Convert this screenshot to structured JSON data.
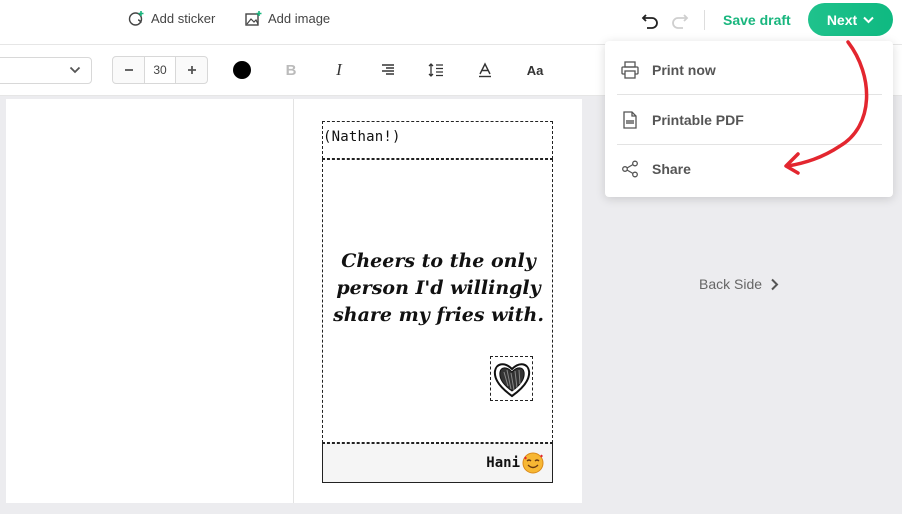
{
  "topbar": {
    "add_sticker": "Add sticker",
    "add_image": "Add image",
    "save_draft": "Save draft",
    "next": "Next"
  },
  "toolbar": {
    "font_size": "30",
    "text_color": "#000000",
    "icons": [
      "bold-icon",
      "italic-icon",
      "align-right-icon",
      "line-height-icon",
      "text-color-icon",
      "text-case-icon"
    ],
    "bold_glyph": "B",
    "italic_glyph": "I",
    "case_glyph": "Aa"
  },
  "card": {
    "name": "(Nathan!)",
    "message": "Cheers to the only person I'd willingly share my fries with.",
    "signature": "Hani"
  },
  "back_side": "Back Side",
  "dropdown": {
    "items": [
      {
        "label": "Print now",
        "icon": "printer-icon"
      },
      {
        "label": "Printable PDF",
        "icon": "pdf-icon"
      },
      {
        "label": "Share",
        "icon": "share-icon"
      }
    ]
  },
  "colors": {
    "accent": "#19b67e",
    "arrow": "#e3262f"
  }
}
